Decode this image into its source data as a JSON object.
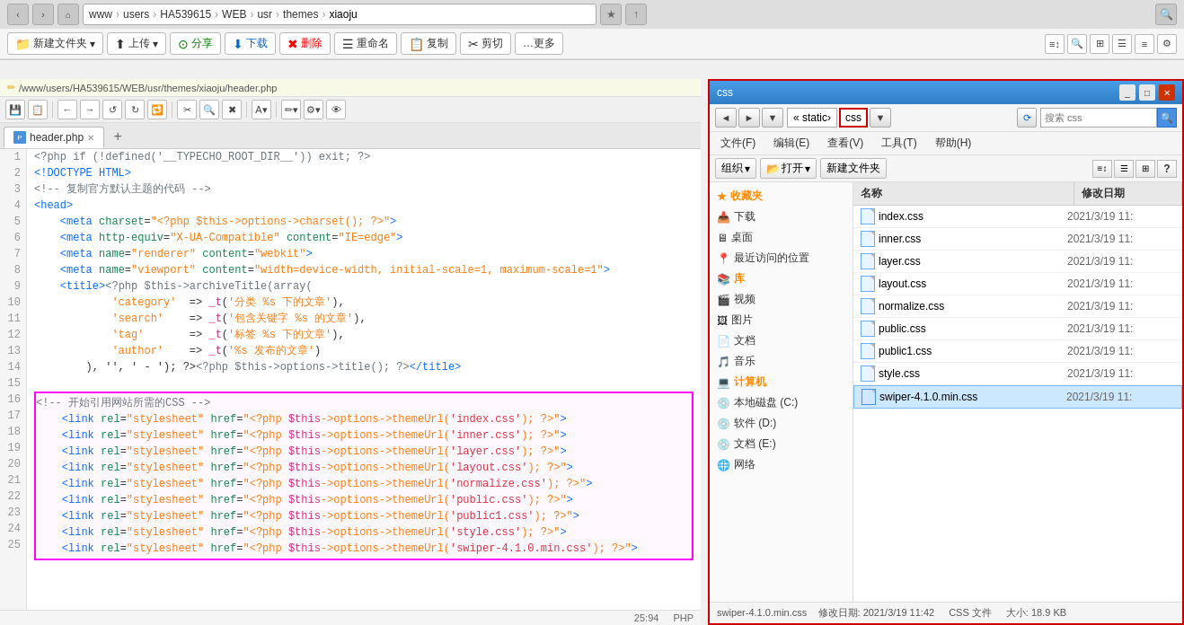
{
  "browser": {
    "nav_back": "‹",
    "nav_forward": "›",
    "nav_home": "⌂",
    "address_parts": [
      "www",
      "users",
      "HA539615",
      "WEB",
      "usr",
      "themes",
      "xiaoju"
    ],
    "star": "★",
    "up_arrow": "↑",
    "search_icon": "🔍",
    "title": "www › users › HA539615 › WEB › usr › themes › xiaoju"
  },
  "ftp_toolbar": {
    "new_folder": "新建文件夹",
    "upload": "上传",
    "share": "分享",
    "download": "下载",
    "delete": "删除",
    "rename": "重命名",
    "copy": "复制",
    "cut": "剪切",
    "more": "…更多"
  },
  "editor": {
    "file_path": "/www/users/HA539615/WEB/usr/themes/xiaoju/header.php",
    "tab_name": "header.php",
    "tab_plus": "+",
    "status": "25:94",
    "lang": "PHP",
    "toolbar_buttons": [
      "💾",
      "📋",
      "←",
      "→",
      "↺",
      "↻",
      "🔁",
      "✂",
      "🔍",
      "✖",
      "A▾",
      "✏▾",
      "⚙▾",
      "👁"
    ],
    "lines": [
      {
        "num": 1,
        "text": "<?php if (!defined('__TYPECHO_ROOT_DIR__')) exit; ?>",
        "highlight": false
      },
      {
        "num": 2,
        "text": "<!DOCTYPE HTML>",
        "highlight": false
      },
      {
        "num": 3,
        "text": "<!-- 复制官方默认主题的代码 -->",
        "highlight": false
      },
      {
        "num": 4,
        "text": "<head>",
        "highlight": false
      },
      {
        "num": 5,
        "text": "    <meta charset=\"<?php $this->options->charset(); ?>\">",
        "highlight": false
      },
      {
        "num": 6,
        "text": "    <meta http-equiv=\"X-UA-Compatible\" content=\"IE=edge\">",
        "highlight": false
      },
      {
        "num": 7,
        "text": "    <meta name=\"renderer\" content=\"webkit\">",
        "highlight": false
      },
      {
        "num": 8,
        "text": "    <meta name=\"viewport\" content=\"width=device-width, initial-scale=1, maximum-scale=1\">",
        "highlight": false
      },
      {
        "num": 9,
        "text": "    <title><?php $this->archiveTitle(array(",
        "highlight": false
      },
      {
        "num": 10,
        "text": "            'category'  => _t('分类 %s 下的文章'),",
        "highlight": false
      },
      {
        "num": 11,
        "text": "            'search'    => _t('包含关键字 %s 的文章'),",
        "highlight": false
      },
      {
        "num": 12,
        "text": "            'tag'       => _t('标签 %s 下的文章'),",
        "highlight": false
      },
      {
        "num": 13,
        "text": "            'author'    => _t('%s 发布的文章')",
        "highlight": false
      },
      {
        "num": 14,
        "text": "        ), '', ' - '); ?><?php $this->options->title(); ?></title>",
        "highlight": false
      },
      {
        "num": 15,
        "text": "",
        "highlight": false
      },
      {
        "num": 16,
        "text": "<!-- 开始引用网站所需的CSS -->",
        "highlight": true
      },
      {
        "num": 17,
        "text": "    <link rel=\"stylesheet\" href=\"<?php $this->options->themeUrl('index.css'); ?>\">",
        "highlight": true
      },
      {
        "num": 18,
        "text": "    <link rel=\"stylesheet\" href=\"<?php $this->options->themeUrl('inner.css'); ?>\">",
        "highlight": true
      },
      {
        "num": 19,
        "text": "    <link rel=\"stylesheet\" href=\"<?php $this->options->themeUrl('layer.css'); ?>\">",
        "highlight": true
      },
      {
        "num": 20,
        "text": "    <link rel=\"stylesheet\" href=\"<?php $this->options->themeUrl('layout.css'); ?>\">",
        "highlight": true
      },
      {
        "num": 21,
        "text": "    <link rel=\"stylesheet\" href=\"<?php $this->options->themeUrl('normalize.css'); ?>\">",
        "highlight": true
      },
      {
        "num": 22,
        "text": "    <link rel=\"stylesheet\" href=\"<?php $this->options->themeUrl('public.css'); ?>\">",
        "highlight": true
      },
      {
        "num": 23,
        "text": "    <link rel=\"stylesheet\" href=\"<?php $this->options->themeUrl('public1.css'); ?>\">",
        "highlight": true
      },
      {
        "num": 24,
        "text": "    <link rel=\"stylesheet\" href=\"<?php $this->options->themeUrl('style.css'); ?>\">",
        "highlight": true
      },
      {
        "num": 25,
        "text": "    <link rel=\"stylesheet\" href=\"<?php $this->options->themeUrl('swiper-4.1.0.min.css'); ?>\">",
        "highlight": true
      }
    ]
  },
  "file_explorer": {
    "title": "css",
    "nav_back": "◄",
    "nav_forward": "►",
    "nav_dropdown": "▼",
    "path_static": "« static",
    "path_css": "css",
    "path_dropdown": "▼",
    "refresh": "⟳",
    "search_placeholder": "搜索 css",
    "search_btn": "🔍",
    "menus": [
      "文件(F)",
      "编辑(E)",
      "查看(V)",
      "工具(T)",
      "帮助(H)"
    ],
    "organize": "组织",
    "open": "打开",
    "new_folder": "新建文件夹",
    "view_icons": [
      "≡",
      "⊞",
      "☰"
    ],
    "help": "?",
    "tree_items": [
      {
        "icon": "★",
        "label": "收藏夹",
        "type": "header"
      },
      {
        "icon": "📥",
        "label": "下载",
        "type": "folder"
      },
      {
        "icon": "🖥",
        "label": "桌面",
        "type": "folder"
      },
      {
        "icon": "📍",
        "label": "最近访问的位置",
        "type": "folder"
      },
      {
        "icon": "📚",
        "label": "库",
        "type": "header"
      },
      {
        "icon": "🎬",
        "label": "视频",
        "type": "folder"
      },
      {
        "icon": "🖼",
        "label": "图片",
        "type": "folder"
      },
      {
        "icon": "📄",
        "label": "文档",
        "type": "folder"
      },
      {
        "icon": "🎵",
        "label": "音乐",
        "type": "folder"
      },
      {
        "icon": "💻",
        "label": "计算机",
        "type": "header"
      },
      {
        "icon": "💿",
        "label": "本地磁盘 (C:)",
        "type": "disk"
      },
      {
        "icon": "💿",
        "label": "软件 (D:)",
        "type": "disk"
      },
      {
        "icon": "💿",
        "label": "文档 (E:)",
        "type": "disk"
      },
      {
        "icon": "🌐",
        "label": "网络",
        "type": "folder"
      }
    ],
    "col_name": "名称",
    "col_date": "修改日期",
    "files": [
      {
        "name": "index.css",
        "date": "2021/3/19 11:",
        "selected": false
      },
      {
        "name": "inner.css",
        "date": "2021/3/19 11:",
        "selected": false
      },
      {
        "name": "layer.css",
        "date": "2021/3/19 11:",
        "selected": false
      },
      {
        "name": "layout.css",
        "date": "2021/3/19 11:",
        "selected": false
      },
      {
        "name": "normalize.css",
        "date": "2021/3/19 11:",
        "selected": false
      },
      {
        "name": "public.css",
        "date": "2021/3/19 11:",
        "selected": false
      },
      {
        "name": "public1.css",
        "date": "2021/3/19 11:",
        "selected": false
      },
      {
        "name": "style.css",
        "date": "2021/3/19 11:",
        "selected": false
      },
      {
        "name": "swiper-4.1.0.min.css",
        "date": "2021/3/19 11:",
        "selected": true
      }
    ],
    "status_name": "swiper-4.1.0.min.css",
    "status_date_label": "修改日期:",
    "status_date": "2021/3/19 11:42",
    "status_type_label": "CSS 文件",
    "status_size_label": "大小:",
    "status_size": "18.9 KB"
  }
}
